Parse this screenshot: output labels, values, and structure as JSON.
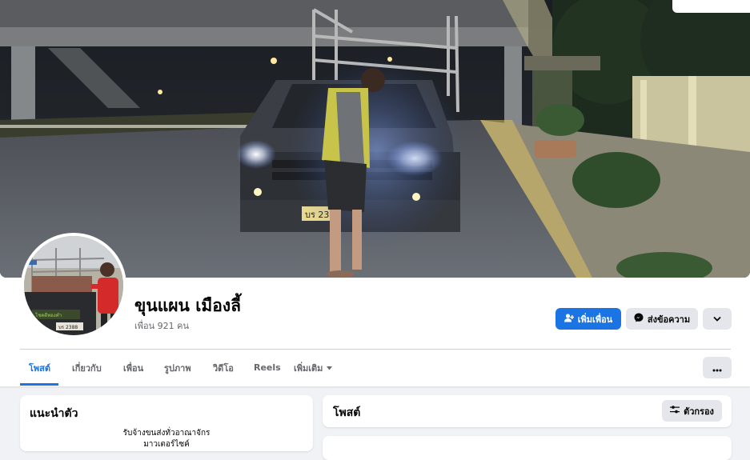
{
  "profile": {
    "name": "ขุนแผน เมืองลี้",
    "friends_text": "เพื่อน 921 คน"
  },
  "actions": {
    "add_friend": "เพิ่มเพื่อน",
    "message": "ส่งข้อความ"
  },
  "tabs": [
    {
      "label": "โพสต์",
      "active": true
    },
    {
      "label": "เกี่ยวกับ",
      "active": false
    },
    {
      "label": "เพื่อน",
      "active": false
    },
    {
      "label": "รูปภาพ",
      "active": false
    },
    {
      "label": "วิดีโอ",
      "active": false
    },
    {
      "label": "Reels",
      "active": false
    },
    {
      "label": "เพิ่มเติม",
      "active": false
    }
  ],
  "intro": {
    "title": "แนะนำตัว",
    "bio_line1": "รับจ้างขนส่งทั่วอาณาจักร",
    "bio_line2": "มาวเตอร์ไซค์"
  },
  "posts": {
    "title": "โพสต์",
    "filter_label": "ตัวกรอง"
  },
  "cover_photo": {
    "license_plate": "บร 23",
    "description_icon": "photo-icon"
  },
  "avatar_photo": {
    "license_plate": "บร 2388"
  },
  "colors": {
    "accent": "#1b74e4",
    "secondary_button": "#e4e6eb",
    "page_background": "#f0f2f5",
    "muted_text": "#65676b"
  }
}
